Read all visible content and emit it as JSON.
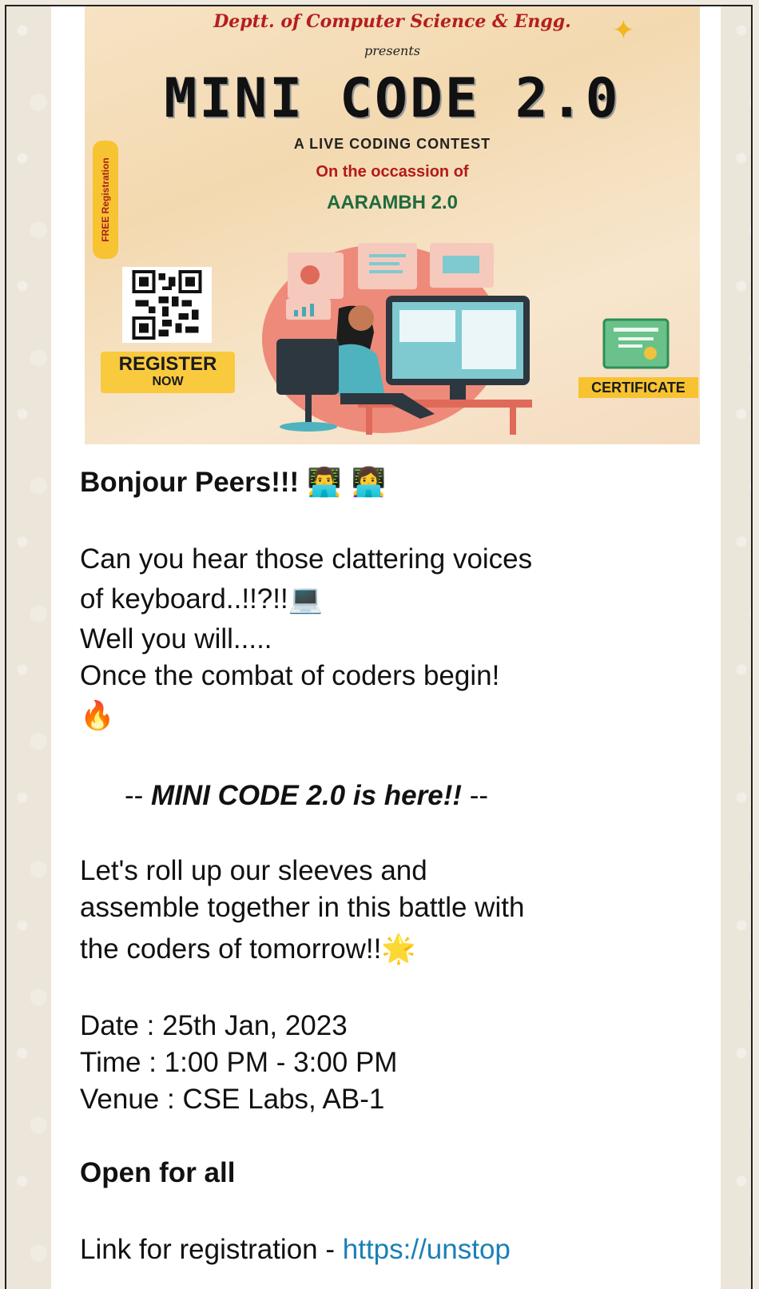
{
  "poster": {
    "dept": "Deptt. of Computer Science & Engg.",
    "presents": "presents",
    "title": "MINI CODE 2.0",
    "subtitle": "A LIVE CODING CONTEST",
    "occasion": "On the occassion of",
    "event": "AARAMBH 2.0",
    "free_tab": "FREE Registration",
    "register_line1": "REGISTER",
    "register_line2": "NOW",
    "certificate": "CERTIFICATE",
    "sparkle_glyph": "✦"
  },
  "message": {
    "greeting": "Bonjour Peers!!!",
    "greeting_emoji": "👨‍💻 👩‍💻",
    "line1": "Can you hear those clattering voices",
    "line2": "of keyboard..!!?!!",
    "line2_emoji": "💻",
    "line3": "Well you will.....",
    "line4": "Once the combat of coders begin!",
    "fire_emoji": "🔥",
    "announce_prefix": "-- ",
    "announce_text": "MINI CODE 2.0 is here!!",
    "announce_suffix": " --",
    "para1": "Let's roll up our sleeves and",
    "para2": "assemble together in this battle with",
    "para3": "the coders of tomorrow!!",
    "star_emoji": "🌟",
    "date": "Date : 25th Jan, 2023",
    "time": "Time : 1:00 PM - 3:00 PM",
    "venue": "Venue : CSE Labs, AB-1",
    "open": "Open for all",
    "link_label": "Link for registration - ",
    "link_url": "https://unstop"
  },
  "colors": {
    "link": "#1b7fb8",
    "dept_red": "#b41e1e",
    "event_green": "#1f6b3f",
    "accent_yellow": "#f7c331"
  }
}
